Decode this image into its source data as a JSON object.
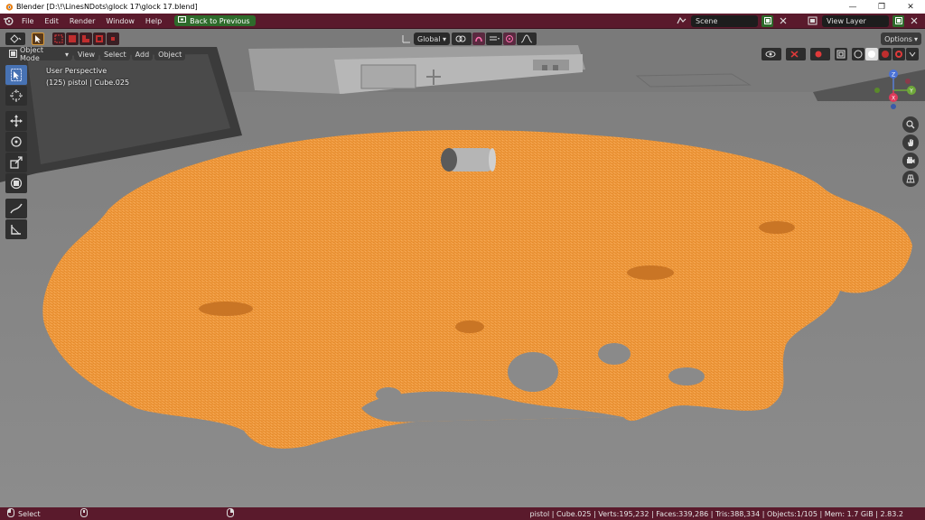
{
  "window": {
    "title": "Blender [D:\\!\\LinesNDots\\glock 17\\glock 17.blend]",
    "minimize": "—",
    "maximize": "❐",
    "close": "✕"
  },
  "topbar": {
    "menu": [
      "File",
      "Edit",
      "Render",
      "Window",
      "Help"
    ],
    "back_button": "Back to Previous",
    "scene_value": "Scene",
    "view_layer_value": "View Layer"
  },
  "viewport_header": {
    "transform_orientation": "Global",
    "options_label": "Options",
    "mode": "Object Mode",
    "menus": [
      "View",
      "Select",
      "Add",
      "Object"
    ]
  },
  "viewport_info": {
    "line1": "User Perspective",
    "line2": "(125) pistol | Cube.025"
  },
  "gizmo": {
    "z": "Z",
    "y": "Y",
    "x": "X"
  },
  "statusbar": {
    "left_label": "Select",
    "stats": "pistol | Cube.025 | Verts:195,232 | Faces:339,286 | Tris:388,334 | Objects:1/105 | Mem: 1.7 GiB | 2.83.2"
  },
  "colors": {
    "accent_topbar": "#5a1a2c",
    "active_tool": "#4772b3",
    "wireframe": "#f0922c",
    "back_button": "#2e6b2b"
  }
}
